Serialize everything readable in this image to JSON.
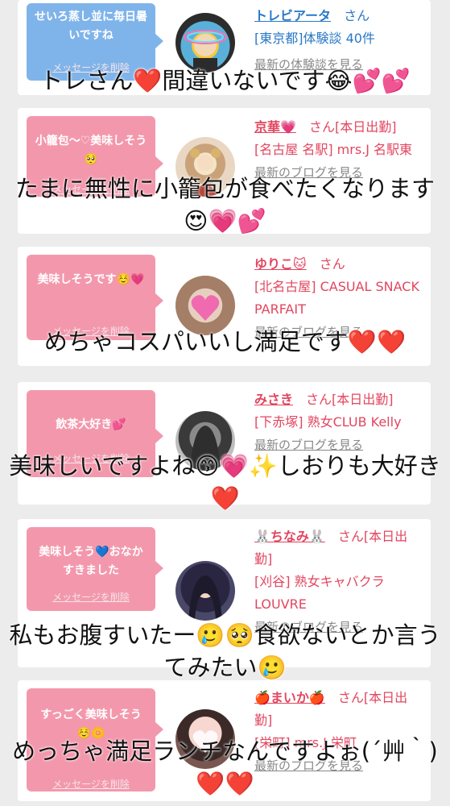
{
  "cards": [
    {
      "bubble": "せいろ蒸し並に毎日暑いですね",
      "bubble_color": "#7fb4ea",
      "delete_label": "メッセージを削除",
      "name": "トレビアータ",
      "name_color": "#2a78c6",
      "san": "さん",
      "shop": "[東京都]体験談 40件",
      "more": "最新の体験談を見る"
    },
    {
      "bubble": "小籠包〜♡美味しそう🥺",
      "bubble_color": "#f398ac",
      "delete_label": "メッセージを削除",
      "name": "京華💗",
      "san": "さん[本日出勤]",
      "shop": "[名古屋 名駅] mrs.J 名駅東",
      "more": "最新のブログを見る"
    },
    {
      "bubble": "美味しそうです☺️💗",
      "bubble_color": "#f398ac",
      "delete_label": "メッセージを削除",
      "name": "ゆりこ🐱",
      "san": "さん",
      "shop": "[北名古屋] CASUAL SNACK PARFAIT",
      "more": "最新のブログを見る"
    },
    {
      "bubble": "飲茶大好き💕",
      "bubble_color": "#f398ac",
      "delete_label": "メッセージを削除",
      "name": "みさき",
      "san": "さん[本日出勤]",
      "shop": "[下赤塚] 熟女CLUB Kelly",
      "more": "最新のブログを見る"
    },
    {
      "bubble": "美味しそう💙おなかすきました",
      "bubble_color": "#f398ac",
      "delete_label": "メッセージを削除",
      "name": "🐰ちなみ🐰",
      "san": "さん[本日出勤]",
      "shop": "[刈谷] 熟女キャバクラ LOUVRE",
      "more": "最新のブログを見る"
    },
    {
      "bubble": "すっごく美味しそう☺️🌼",
      "bubble_color": "#f398ac",
      "delete_label": "メッセージを削除",
      "name": "🍎まいか🍎",
      "san": "さん[本日出勤]",
      "shop": "[栄町] mrs.J 栄町",
      "more": "最新のブログを見る"
    }
  ],
  "overlays": [
    "トレさん❤️間違いないです😂💕💕",
    "たまに無性に小籠包が食べたくなります😍💗💕",
    "めちゃコスパいいし満足です❤️❤️",
    "美味しいですよね😙💗✨しおりも大好き❤️",
    "私もお腹すいたー🥲🥺食欲ないとか言うてみたい🥲",
    "めっちゃ満足ランチなんですよぉ(´艸｀)❤️❤️"
  ]
}
